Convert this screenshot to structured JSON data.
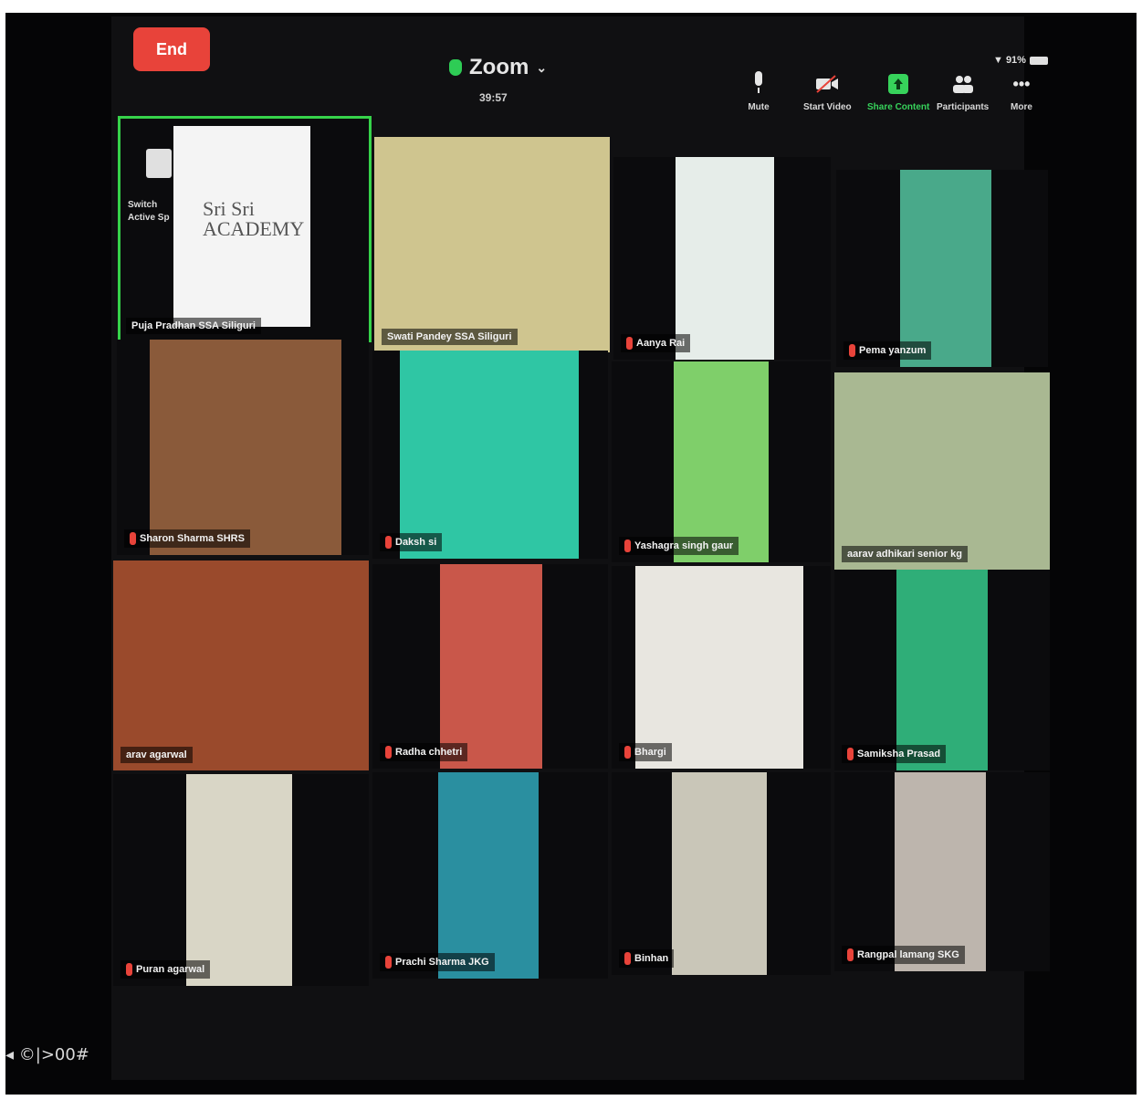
{
  "header": {
    "end_label": "End",
    "app_title": "Zoom",
    "timer": "39:57",
    "status": "▼ 91%"
  },
  "toolbar": [
    {
      "label": "Mute",
      "icon": "mic-icon"
    },
    {
      "label": "Start Video",
      "icon": "video-off-icon"
    },
    {
      "label": "Share Content",
      "icon": "share-screen-icon"
    },
    {
      "label": "Participants",
      "icon": "participants-icon"
    },
    {
      "label": "More",
      "icon": "more-icon"
    }
  ],
  "active_tile": {
    "switch_label": "Switch Active Sp",
    "logo": "Sri Sri ACADEMY"
  },
  "participants": [
    {
      "name": "Puja Pradhan SSA Siliguri",
      "muted": false,
      "active": true
    },
    {
      "name": "Swati Pandey SSA Siliguri",
      "muted": false
    },
    {
      "name": "Aanya Rai",
      "muted": true
    },
    {
      "name": "Pema yanzum",
      "muted": true
    },
    {
      "name": "Sharon Sharma SHRS",
      "muted": true
    },
    {
      "name": "Daksh si",
      "muted": true
    },
    {
      "name": "Yashagra singh gaur",
      "muted": true
    },
    {
      "name": "aarav adhikari senior kg",
      "muted": false
    },
    {
      "name": "arav agarwal",
      "muted": false
    },
    {
      "name": "Radha chhetri",
      "muted": true
    },
    {
      "name": "Bhargi",
      "muted": true
    },
    {
      "name": "Samiksha Prasad",
      "muted": true
    },
    {
      "name": "Puran agarwal",
      "muted": true
    },
    {
      "name": "Prachi Sharma JKG",
      "muted": true
    },
    {
      "name": "Binhan",
      "muted": true
    },
    {
      "name": "Rangpal lamang SKG",
      "muted": true
    }
  ],
  "bottom_bar": "◂ ©|>00#",
  "colors": {
    "accent": "#36d34a",
    "end": "#e8433a",
    "background": "#101012"
  }
}
